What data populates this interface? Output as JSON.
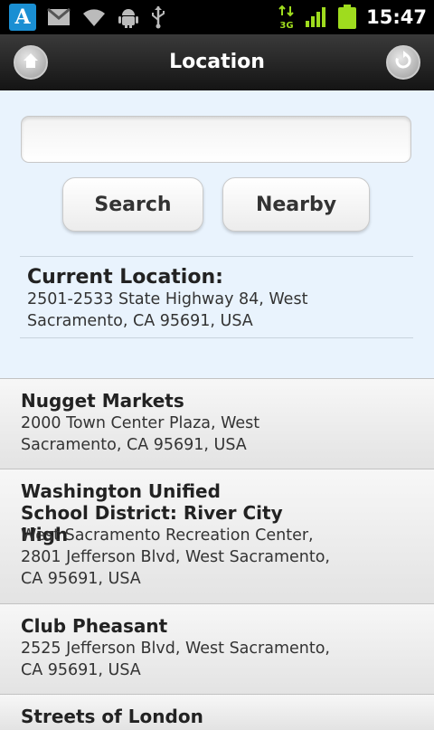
{
  "status_bar": {
    "app_icon_letter": "A",
    "time": "15:47",
    "network_label": "3G",
    "icons": [
      "app-icon",
      "gmail-icon",
      "wifi-icon",
      "android-debug-icon",
      "usb-icon",
      "data-arrows-icon",
      "signal-icon",
      "battery-icon"
    ]
  },
  "header": {
    "title": "Location",
    "left_icon": "home-icon",
    "right_icon": "refresh-icon"
  },
  "search": {
    "input_value": "",
    "input_placeholder": "",
    "search_label": "Search",
    "nearby_label": "Nearby"
  },
  "current_location": {
    "title": "Current Location:",
    "address": "2501-2533 State Highway 84, West Sacramento, CA 95691, USA"
  },
  "results": [
    {
      "name": "Nugget Markets",
      "address": "2000 Town Center Plaza, West Sacramento, CA 95691, USA"
    },
    {
      "name": "Washington Unified School District: River City High",
      "address": "West Sacramento Recreation Center, 2801 Jefferson Blvd, West Sacramento, CA 95691, USA"
    },
    {
      "name": "Club Pheasant",
      "address": "2525 Jefferson Blvd, West Sacramento, CA 95691, USA"
    },
    {
      "name": "Streets of London",
      "address": ""
    }
  ],
  "colors": {
    "panel_background": "#e9f3fd",
    "titlebar": "#1e1e1e",
    "battery": "#9fdc1e",
    "signal": "#9fdc1e"
  }
}
